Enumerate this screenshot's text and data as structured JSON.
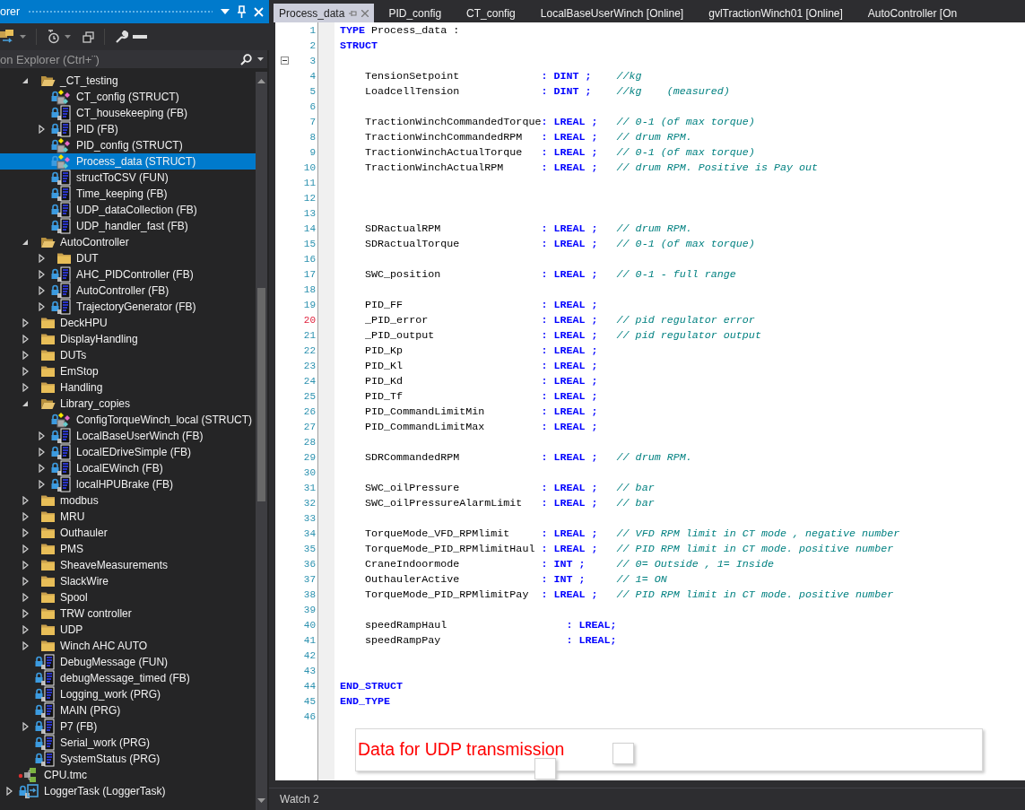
{
  "explorer": {
    "title": "orer",
    "search": {
      "placeholder": "on Explorer (Ctrl+¨)"
    },
    "tree": {
      "scrolled_branch": [
        {
          "label": "_CT_testing",
          "kind": "folder",
          "expanded": true,
          "selected": false,
          "children": [
            {
              "label": "CT_config (STRUCT)",
              "kind": "struct",
              "selected": false
            },
            {
              "label": "CT_housekeeping (FB)",
              "kind": "pou",
              "selected": false
            },
            {
              "label": "PID (FB)",
              "kind": "pou",
              "expanded": false,
              "selected": false
            },
            {
              "label": "PID_config (STRUCT)",
              "kind": "struct",
              "selected": false
            },
            {
              "label": "Process_data (STRUCT)",
              "kind": "struct",
              "selected": true
            },
            {
              "label": "structToCSV (FUN)",
              "kind": "pou",
              "selected": false
            },
            {
              "label": "Time_keeping (FB)",
              "kind": "pou",
              "selected": false
            },
            {
              "label": "UDP_dataCollection (FB)",
              "kind": "pou",
              "selected": false
            },
            {
              "label": "UDP_handler_fast (FB)",
              "kind": "pou",
              "selected": false
            }
          ]
        },
        {
          "label": "AutoController",
          "kind": "folder",
          "expanded": true,
          "selected": false,
          "children": [
            {
              "label": "DUT",
              "kind": "folder",
              "expanded": false,
              "selected": false
            },
            {
              "label": "AHC_PIDController (FB)",
              "kind": "pou",
              "expanded": false,
              "selected": false
            },
            {
              "label": "AutoController (FB)",
              "kind": "pou",
              "expanded": false,
              "selected": false
            },
            {
              "label": "TrajectoryGenerator (FB)",
              "kind": "pou",
              "expanded": false,
              "selected": false
            }
          ]
        },
        {
          "label": "DeckHPU",
          "kind": "folder",
          "expanded": false,
          "selected": false
        },
        {
          "label": "DisplayHandling",
          "kind": "folder",
          "expanded": false,
          "selected": false
        },
        {
          "label": "DUTs",
          "kind": "folder",
          "expanded": false,
          "selected": false
        },
        {
          "label": "EmStop",
          "kind": "folder",
          "expanded": false,
          "selected": false
        },
        {
          "label": "Handling",
          "kind": "folder",
          "expanded": false,
          "selected": false
        },
        {
          "label": "Library_copies",
          "kind": "folder",
          "expanded": true,
          "selected": false,
          "children": [
            {
              "label": "ConfigTorqueWinch_local (STRUCT)",
              "kind": "struct",
              "selected": false
            },
            {
              "label": "LocalBaseUserWinch (FB)",
              "kind": "pou",
              "expanded": false,
              "selected": false
            },
            {
              "label": "LocalEDriveSimple (FB)",
              "kind": "pou",
              "expanded": false,
              "selected": false
            },
            {
              "label": "LocalEWinch (FB)",
              "kind": "pou",
              "expanded": false,
              "selected": false
            },
            {
              "label": "localHPUBrake (FB)",
              "kind": "pou",
              "expanded": false,
              "selected": false
            }
          ]
        },
        {
          "label": "modbus",
          "kind": "folder",
          "expanded": false,
          "selected": false
        },
        {
          "label": "MRU",
          "kind": "folder",
          "expanded": false,
          "selected": false
        },
        {
          "label": "Outhauler",
          "kind": "folder",
          "expanded": false,
          "selected": false
        },
        {
          "label": "PMS",
          "kind": "folder",
          "expanded": false,
          "selected": false
        },
        {
          "label": "SheaveMeasurements",
          "kind": "folder",
          "expanded": false,
          "selected": false
        },
        {
          "label": "SlackWire",
          "kind": "folder",
          "expanded": false,
          "selected": false
        },
        {
          "label": "Spool",
          "kind": "folder",
          "expanded": false,
          "selected": false
        },
        {
          "label": "TRW controller",
          "kind": "folder",
          "expanded": false,
          "selected": false
        },
        {
          "label": "UDP",
          "kind": "folder",
          "expanded": false,
          "selected": false
        },
        {
          "label": "Winch AHC AUTO",
          "kind": "folder",
          "expanded": false,
          "selected": false
        },
        {
          "label": "DebugMessage (FUN)",
          "kind": "pou",
          "selected": false
        },
        {
          "label": "debugMessage_timed (FB)",
          "kind": "pou",
          "selected": false
        },
        {
          "label": "Logging_work (PRG)",
          "kind": "pou",
          "selected": false
        },
        {
          "label": "MAIN (PRG)",
          "kind": "pou",
          "selected": false
        },
        {
          "label": "P7 (FB)",
          "kind": "pou",
          "expanded": false,
          "selected": false
        },
        {
          "label": "Serial_work (PRG)",
          "kind": "pou",
          "selected": false
        },
        {
          "label": "SystemStatus (PRG)",
          "kind": "pou",
          "selected": false
        }
      ],
      "items": [
        {
          "label": "CPU.tmc",
          "kind": "tmc",
          "selected": false
        },
        {
          "label": "LoggerTask (LoggerTask)",
          "kind": "task",
          "expanded": false,
          "selected": false
        }
      ]
    }
  },
  "editor": {
    "tabs": [
      {
        "label": "Process_data",
        "selected": true
      },
      {
        "label": "PID_config",
        "selected": false
      },
      {
        "label": "CT_config",
        "selected": false
      },
      {
        "label": "LocalBaseUserWinch [Online]",
        "selected": false
      },
      {
        "label": "gvlTractionWinch01 [Online]",
        "selected": false
      },
      {
        "label": "AutoController [On",
        "selected": false
      }
    ],
    "lines": [
      {
        "number": "1",
        "kind": "header",
        "keyword": "TYPE",
        "text": "Process_data :",
        "flagged": false,
        "fold": false
      },
      {
        "number": "2",
        "kind": "keyword",
        "keyword": "STRUCT",
        "flagged": false,
        "fold": false
      },
      {
        "number": "3",
        "kind": "blank",
        "flagged": false,
        "fold": true
      },
      {
        "number": "4",
        "kind": "decl",
        "name": "TensionSetpoint",
        "type": ": DINT ;",
        "comment": "//kg",
        "flagged": false,
        "fold": false
      },
      {
        "number": "5",
        "kind": "decl",
        "name": "LoadcellTension",
        "type": ": DINT ;",
        "comment": "//kg    (measured)",
        "flagged": false,
        "fold": false
      },
      {
        "number": "6",
        "kind": "blank",
        "flagged": false,
        "fold": false
      },
      {
        "number": "7",
        "kind": "decl",
        "name": "TractionWinchCommandedTorque",
        "type": ": LREAL ;",
        "comment": "// 0-1 (of max torque)",
        "flagged": false,
        "fold": false
      },
      {
        "number": "8",
        "kind": "decl",
        "name": "TractionWinchCommandedRPM",
        "type": ": LREAL ;",
        "comment": "// drum RPM.",
        "flagged": false,
        "fold": false
      },
      {
        "number": "9",
        "kind": "decl",
        "name": "TractionWinchActualTorque",
        "type": ": LREAL ;",
        "comment": "// 0-1 (of max torque)",
        "flagged": false,
        "fold": false
      },
      {
        "number": "10",
        "kind": "decl",
        "name": "TractionWinchActualRPM",
        "type": ": LREAL ;",
        "comment": "// drum RPM. Positive is Pay out",
        "flagged": false,
        "fold": false
      },
      {
        "number": "11",
        "kind": "blank",
        "flagged": false,
        "fold": false
      },
      {
        "number": "12",
        "kind": "blank",
        "flagged": false,
        "fold": false
      },
      {
        "number": "13",
        "kind": "blank",
        "flagged": false,
        "fold": false
      },
      {
        "number": "14",
        "kind": "decl",
        "name": "SDRactualRPM",
        "type": ": LREAL ;",
        "comment": "// drum RPM.",
        "flagged": false,
        "fold": false
      },
      {
        "number": "15",
        "kind": "decl",
        "name": "SDRactualTorque",
        "type": ": LREAL ;",
        "comment": "// 0-1 (of max torque)",
        "flagged": false,
        "fold": false
      },
      {
        "number": "16",
        "kind": "blank",
        "flagged": false,
        "fold": false
      },
      {
        "number": "17",
        "kind": "decl",
        "name": "SWC_position",
        "type": ": LREAL ;",
        "comment": "// 0-1 - full range",
        "flagged": false,
        "fold": false
      },
      {
        "number": "18",
        "kind": "blank",
        "flagged": false,
        "fold": false
      },
      {
        "number": "19",
        "kind": "decl",
        "name": "PID_FF",
        "type": ": LREAL ;",
        "flagged": false,
        "fold": false
      },
      {
        "number": "20",
        "kind": "decl",
        "name": "_PID_error",
        "type": ": LREAL ;",
        "comment": "// pid regulator error",
        "flagged": true,
        "fold": false
      },
      {
        "number": "21",
        "kind": "decl",
        "name": "_PID_output",
        "type": ": LREAL ;",
        "comment": "// pid regulator output",
        "flagged": false,
        "fold": false
      },
      {
        "number": "22",
        "kind": "decl",
        "name": "PID_Kp",
        "type": ": LREAL ;",
        "flagged": false,
        "fold": false
      },
      {
        "number": "23",
        "kind": "decl",
        "name": "PID_Kl",
        "type": ": LREAL ;",
        "flagged": false,
        "fold": false
      },
      {
        "number": "24",
        "kind": "decl",
        "name": "PID_Kd",
        "type": ": LREAL ;",
        "flagged": false,
        "fold": false
      },
      {
        "number": "25",
        "kind": "decl",
        "name": "PID_Tf",
        "type": ": LREAL ;",
        "flagged": false,
        "fold": false
      },
      {
        "number": "26",
        "kind": "decl",
        "name": "PID_CommandLimitMin",
        "type": ": LREAL ;",
        "flagged": false,
        "fold": false
      },
      {
        "number": "27",
        "kind": "decl",
        "name": "PID_CommandLimitMax",
        "type": ": LREAL ;",
        "flagged": false,
        "fold": false
      },
      {
        "number": "28",
        "kind": "blank",
        "flagged": false,
        "fold": false
      },
      {
        "number": "29",
        "kind": "decl",
        "name": "SDRCommandedRPM",
        "type": ": LREAL ;",
        "comment": "// drum RPM.",
        "flagged": false,
        "fold": false
      },
      {
        "number": "30",
        "kind": "blank",
        "flagged": false,
        "fold": false
      },
      {
        "number": "31",
        "kind": "decl",
        "name": "SWC_oilPressure",
        "type": ": LREAL ;",
        "comment": "// bar",
        "flagged": false,
        "fold": false
      },
      {
        "number": "32",
        "kind": "decl",
        "name": "SWC_oilPressureAlarmLimit",
        "type": ": LREAL ;",
        "comment": "// bar",
        "flagged": false,
        "fold": false
      },
      {
        "number": "33",
        "kind": "blank",
        "flagged": false,
        "fold": false
      },
      {
        "number": "34",
        "kind": "decl",
        "name": "TorqueMode_VFD_RPMlimit",
        "type": ": LREAL ;",
        "comment": "// VFD RPM limit in CT mode , negative number",
        "flagged": false,
        "fold": false
      },
      {
        "number": "35",
        "kind": "decl",
        "name": "TorqueMode_PID_RPMlimitHaul",
        "type": ": LREAL ;",
        "comment": "// PID RPM limit in CT mode. positive number",
        "flagged": false,
        "fold": false
      },
      {
        "number": "36",
        "kind": "decl",
        "name": "CraneIndoormode",
        "type": ": INT ;",
        "comment": "// 0= Outside , 1= Inside",
        "flagged": false,
        "fold": false
      },
      {
        "number": "37",
        "kind": "decl",
        "name": "OuthaulerActive",
        "type": ": INT ;",
        "comment": "// 1= ON",
        "flagged": false,
        "fold": false
      },
      {
        "number": "38",
        "kind": "decl",
        "name": "TorqueMode_PID_RPMlimitPay",
        "type": ": LREAL ;",
        "comment": "// PID RPM limit in CT mode. positive number",
        "flagged": false,
        "fold": false
      },
      {
        "number": "39",
        "kind": "blank",
        "flagged": false,
        "fold": false
      },
      {
        "number": "40",
        "kind": "decl_wide",
        "name": "speedRampHaul",
        "type": ": LREAL;",
        "flagged": false,
        "fold": false
      },
      {
        "number": "41",
        "kind": "decl_wide",
        "name": "speedRampPay",
        "type": ": LREAL;",
        "flagged": false,
        "fold": false
      },
      {
        "number": "42",
        "kind": "blank",
        "flagged": false,
        "fold": false
      },
      {
        "number": "43",
        "kind": "blank",
        "flagged": false,
        "fold": false
      },
      {
        "number": "44",
        "kind": "keyword",
        "keyword": "END_STRUCT",
        "flagged": false,
        "fold": false
      },
      {
        "number": "45",
        "kind": "keyword",
        "keyword": "END_TYPE",
        "flagged": false,
        "fold": false
      },
      {
        "number": "46",
        "kind": "blank",
        "flagged": false,
        "fold": false
      }
    ],
    "comment_box": {
      "text": "Data for UDP transmission"
    }
  },
  "bottom_panel": {
    "tab": "Watch 2"
  }
}
